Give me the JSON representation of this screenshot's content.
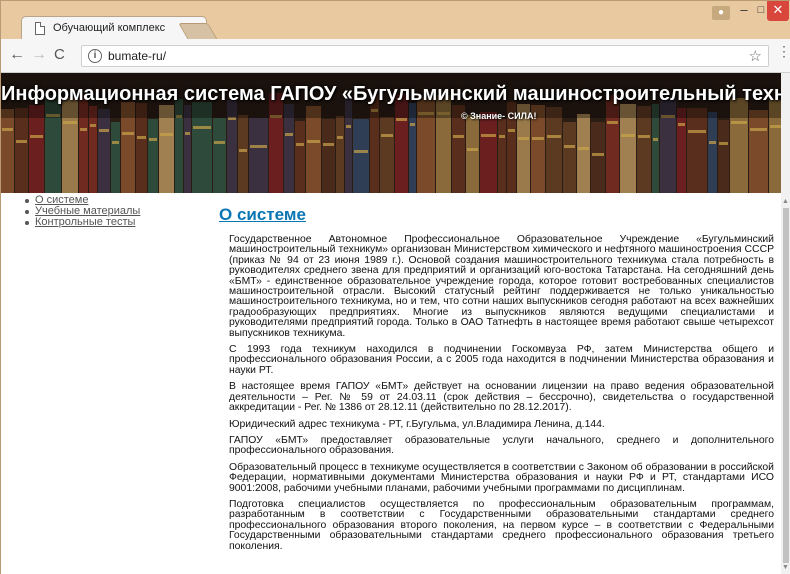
{
  "browser": {
    "tab_title": "Обучающий комплекс",
    "tab_close": "×",
    "url": "bumate-ru/",
    "info_icon": "i",
    "star_icon": "☆",
    "back_icon": "←",
    "forward_icon": "→",
    "reload_icon": "C",
    "menu_icon": "⋮",
    "min_icon": "–",
    "max_icon": "□",
    "close_icon": "✕",
    "user_icon": "👤"
  },
  "banner": {
    "title": "Информационная система ГАПОУ «Бугульминский машиностроительный техникум»",
    "subtitle": "© Знание- СИЛА!"
  },
  "nav": {
    "items": [
      {
        "label": "О системе"
      },
      {
        "label": "Учебные материалы"
      },
      {
        "label": "Контрольные тесты"
      }
    ]
  },
  "main": {
    "heading": "О системе",
    "paragraphs": [
      "Государственное Автономное Профессиональное Образовательное Учреждение «Бугульминский машиностроительный техникум» организован Министерством химического и нефтяного машиностроения СССР (приказ № 94 от 23 июня 1989 г.). Основой создания машиностроительного техникума стала потребность в руководителях среднего звена для предприятий и организаций юго-востока Татарстана. На сегодняшний день «БМТ» - единственное образовательное учреждение города, которое готовит востребованных специалистов машиностроительной отрасли. Высокий статусный рейтинг поддерживается не только уникальностью машиностроительного техникума, но и тем, что сотни наших выпускников сегодня работают на всех важнейших градообразующих предприятиях. Многие из выпускников являются ведущими специалистами и руководителями предприятий города. Только в ОАО Татнефть в настоящее время работают свыше четырехсот выпускников техникума.",
      "С 1993 года техникум находился в подчинении Госкомвуза РФ, затем Министерства общего и профессионального образования России, а с 2005 года находится в подчинении Министерства образования и науки РТ.",
      "В настоящее время ГАПОУ «БМТ» действует на основании лицензии на право ведения образовательной деятельности – Рег. № 59 от 24.03.11 (срок действия – бессрочно), свидетельства о государственной аккредитации - Рег. № 1386 от 28.12.11 (действительно по 28.12.2017).",
      "Юридический адрес техникума - РТ, г.Бугульма, ул.Владимира Ленина, д.144.",
      "ГАПОУ «БМТ» предоставляет образовательные услуги начального, среднего и дополнительного профессионального образования.",
      "Образовательный процесс в техникуме осуществляется в соответствии с Законом об образовании в российской Федерации, нормативными документами Министерства образования и науки РФ и РТ, стандартами ИСО 9001:2008, рабочими учебными планами, рабочими учебными программами по дисциплинам.",
      "Подготовка специалистов осуществляется по профессиональным образовательным программам, разработанным в соответствии с Государственными образовательными стандартами среднего профессионального образования второго поколения, на первом курсе – в соответствии с Федеральными Государственными образовательными стандартами среднего профессионального образования третьего поколения."
    ]
  },
  "colors": {
    "chrome_frame": "#e8c9a0",
    "heading_link": "#0a76b3",
    "close_button": "#d9473c"
  }
}
